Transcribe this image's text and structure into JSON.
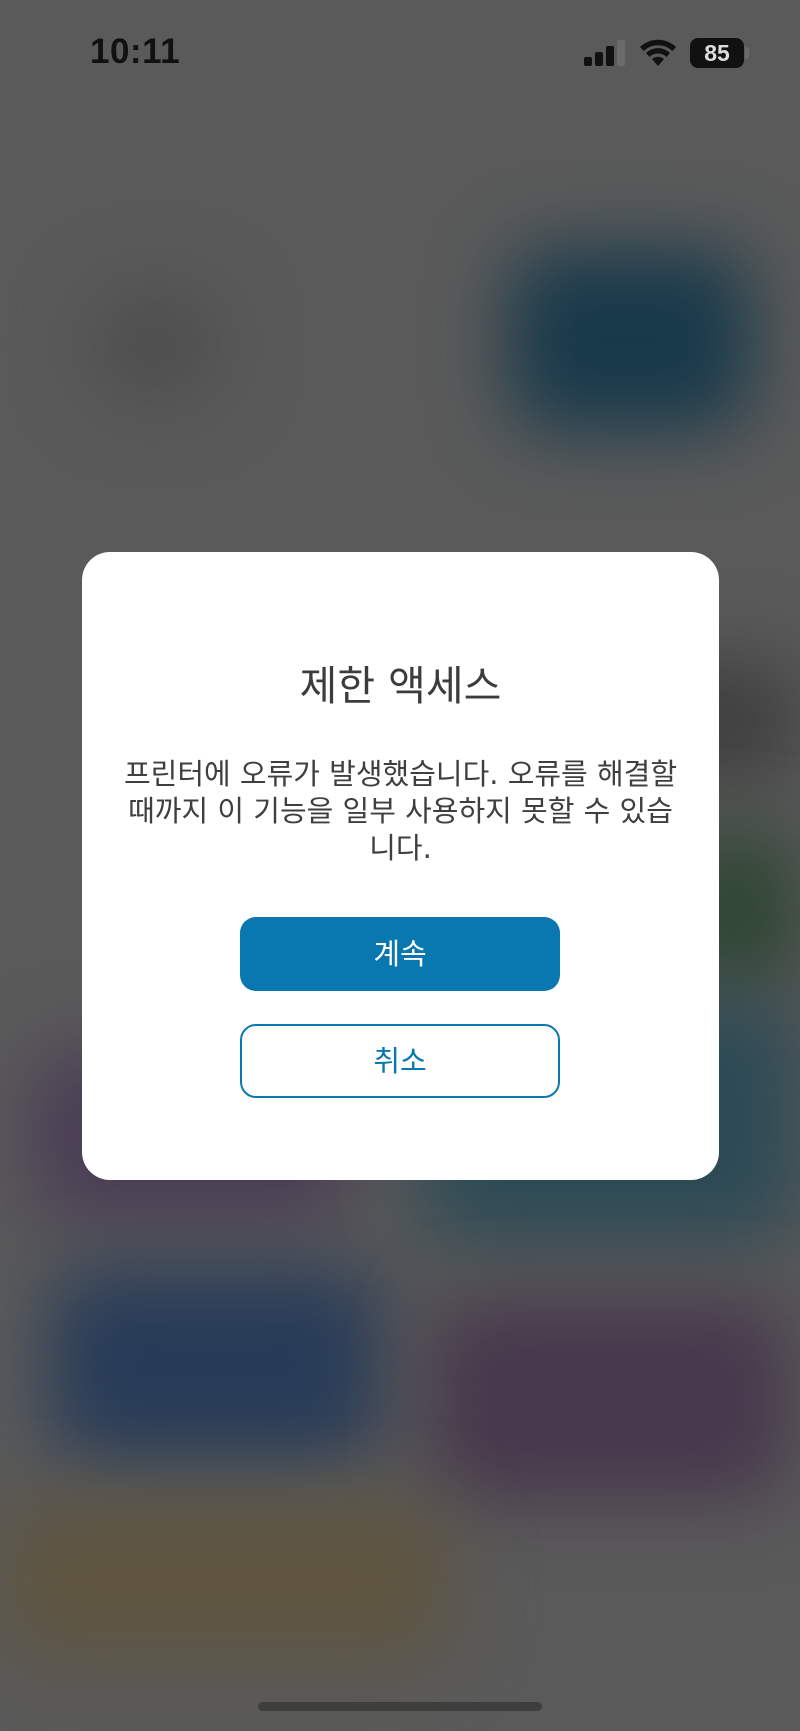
{
  "status_bar": {
    "time": "10:11",
    "battery": "85",
    "icons": [
      "cellular-signal-icon",
      "wifi-icon",
      "battery-icon"
    ]
  },
  "dialog": {
    "title": "제한 액세스",
    "message": "프린터에 오류가 발생했습니다. 오류를 해결할 때까지 이 기능을 일부 사용하지 못할 수 있습니다.",
    "primary_label": "계속",
    "secondary_label": "취소"
  },
  "colors": {
    "accent": "#0a78b0",
    "dialog_background": "#ffffff",
    "overlay": "#5a5a5a"
  }
}
